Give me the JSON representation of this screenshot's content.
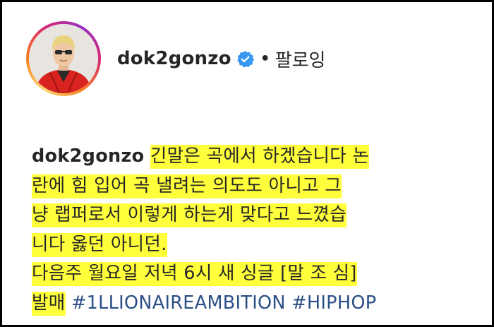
{
  "post_header": {
    "username": "dok2gonzo",
    "verified_icon": "verified-badge-icon",
    "separator": "•",
    "follow_status": "팔로잉"
  },
  "caption": {
    "username": "dok2gonzo",
    "lines": [
      "긴말은 곡에서 하겠습니다 논",
      "란에 힘 입어 곡 낼려는 의도도 아니고 그",
      "냥 랩퍼로서 이렇게 하는게 맞다고 느꼈습",
      "니다 옳던 아니던.",
      "다음주 월요일 저녁 6시 새 싱글 [말 조 심]",
      "발매"
    ],
    "hashtags": [
      "#1LLIONAIREAMBITION",
      "#HIPHOP"
    ]
  },
  "colors": {
    "highlight": "#ffff3c",
    "hashtag": "#2a4e86",
    "verified": "#3897f0",
    "text": "#262626"
  }
}
